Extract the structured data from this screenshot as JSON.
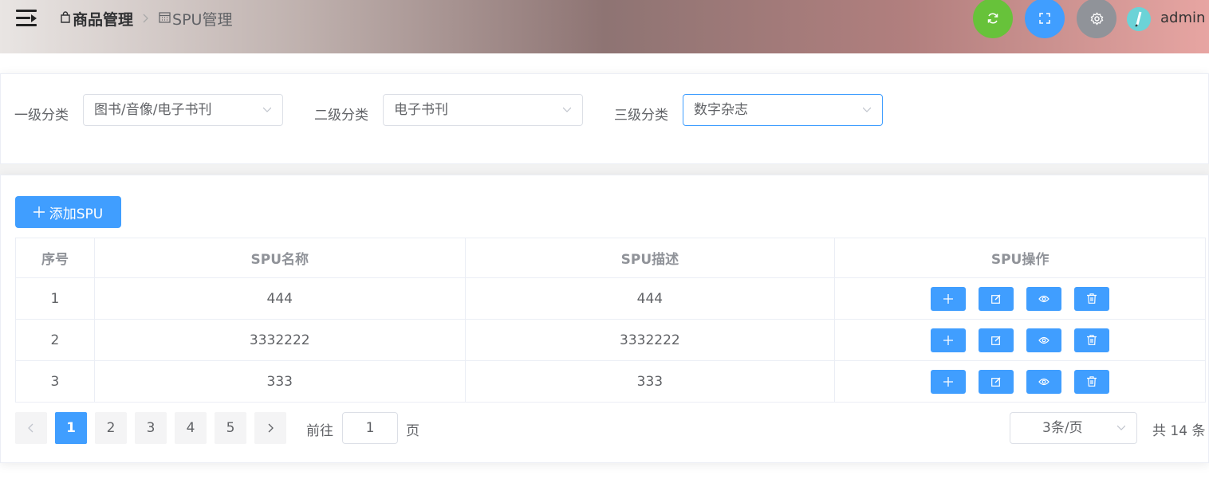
{
  "header": {
    "breadcrumb": [
      {
        "icon": "shopping-bag-icon",
        "label": "商品管理"
      },
      {
        "icon": "calendar-icon",
        "label": "SPU管理"
      }
    ],
    "username": "admin",
    "colors": {
      "refresh": "#67c23a",
      "fullscreen": "#409eff",
      "settings": "#909399"
    }
  },
  "filters": {
    "category1": {
      "label": "一级分类",
      "value": "图书/音像/电子书刊"
    },
    "category2": {
      "label": "二级分类",
      "value": "电子书刊"
    },
    "category3": {
      "label": "三级分类",
      "value": "数字杂志"
    }
  },
  "toolbar": {
    "add_label": "添加SPU"
  },
  "table": {
    "headers": [
      "序号",
      "SPU名称",
      "SPU描述",
      "SPU操作"
    ],
    "rows": [
      {
        "index": "1",
        "name": "444",
        "desc": "444"
      },
      {
        "index": "2",
        "name": "3332222",
        "desc": "3332222"
      },
      {
        "index": "3",
        "name": "333",
        "desc": "333"
      }
    ]
  },
  "pagination": {
    "prev": "‹",
    "next": "›",
    "pages": [
      "1",
      "2",
      "3",
      "4",
      "5"
    ],
    "current": "1",
    "goto_prefix": "前往",
    "goto_value": "1",
    "goto_suffix": "页",
    "page_size": "3条/页",
    "total": "共 14 条"
  },
  "accent_color": "#409eff"
}
